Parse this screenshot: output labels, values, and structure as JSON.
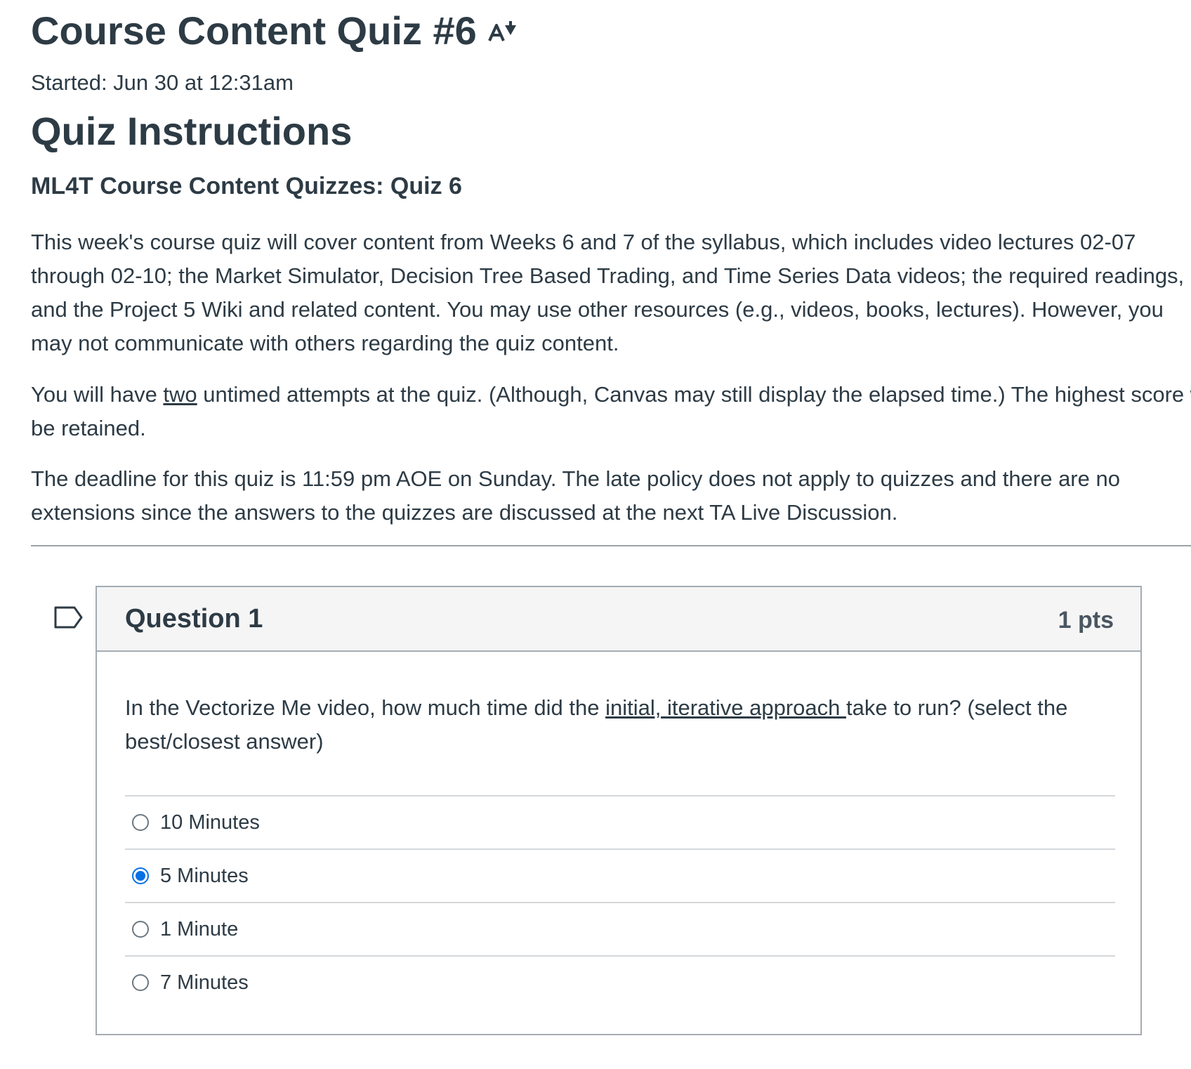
{
  "quiz": {
    "title": "Course Content Quiz #6",
    "started": "Started: Jun 30 at 12:31am"
  },
  "instructions": {
    "heading": "Quiz Instructions",
    "subheading": "ML4T Course Content Quizzes: Quiz 6",
    "p1": "This week's course quiz will cover content from Weeks 6 and 7 of the syllabus, which includes video lectures 02-07 through 02-10; the Market Simulator, Decision Tree Based Trading, and Time Series Data videos; the required readings, and the Project 5 Wiki and related content. You may use other resources (e.g., videos, books, lectures). However, you may not communicate with others regarding the quiz content.",
    "p2_before": "You will have ",
    "p2_underlined": "two",
    "p2_after": " untimed attempts at the quiz. (Although, Canvas may still display the elapsed time.) The highest score will be retained.",
    "p3": "The deadline for this quiz is 11:59 pm AOE on Sunday. The late policy does not apply to quizzes and there are no extensions since the answers to the quizzes are discussed at the next TA Live Discussion."
  },
  "question": {
    "name": "Question 1",
    "points": "1 pts",
    "text_before": "In the Vectorize Me video, how much time did the ",
    "text_underlined": "initial, iterative approach ",
    "text_after": "take to run? (select the best/closest answer)",
    "answers": [
      {
        "label": "10 Minutes",
        "selected": false
      },
      {
        "label": "5 Minutes",
        "selected": true
      },
      {
        "label": "1 Minute",
        "selected": false
      },
      {
        "label": "7 Minutes",
        "selected": false
      }
    ]
  },
  "icons": {
    "title_action": "immersive-reader-icon",
    "question_flag": "flag-question-icon"
  },
  "colors": {
    "text": "#2d3b45",
    "accent": "#0770e3",
    "header_bg": "#f5f5f5"
  }
}
